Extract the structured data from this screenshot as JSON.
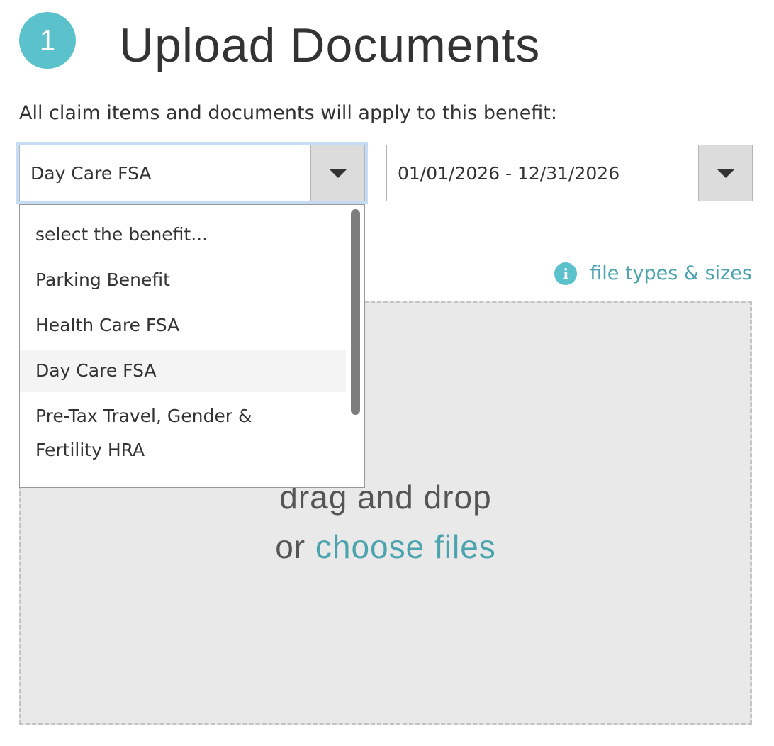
{
  "step": {
    "number": "1",
    "title": "Upload Documents"
  },
  "instruction": "All claim items and documents will apply to this benefit:",
  "benefit_select": {
    "value": "Day Care FSA",
    "open": true,
    "options": [
      "select the benefit...",
      "Parking Benefit",
      "Health Care FSA",
      "Day Care FSA",
      "Pre-Tax Travel, Gender & Fertility HRA"
    ],
    "selected_index": 3
  },
  "period_select": {
    "value": "01/01/2026 - 12/31/2026"
  },
  "file_info": {
    "icon": "info-icon",
    "label": "file types & sizes"
  },
  "dropzone": {
    "line1": "drag and drop",
    "line2_prefix": "or ",
    "line2_link": "choose files"
  },
  "colors": {
    "accent": "#5bc2cc",
    "link": "#4aa3ad",
    "focus_ring": "#c5dcf5",
    "dropzone_bg": "#e9e9e9"
  }
}
